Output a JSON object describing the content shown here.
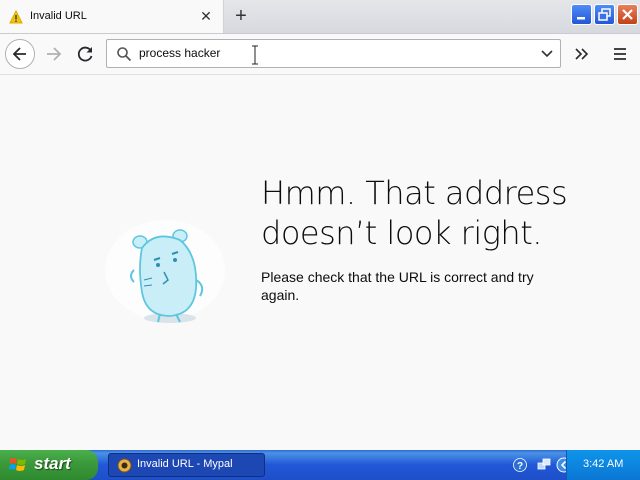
{
  "browser": {
    "tab": {
      "title": "Invalid URL",
      "warning_icon": "warning-icon",
      "close_icon": "close-icon"
    },
    "new_tab_icon": "plus-icon",
    "window_controls": {
      "minimize": "minimize-icon",
      "maximize": "restore-icon",
      "close": "close-icon"
    }
  },
  "toolbar": {
    "back_icon": "arrow-left-icon",
    "forward_icon": "arrow-right-icon",
    "reload_icon": "reload-icon",
    "url_value": "process hacker",
    "url_search_icon": "search-icon",
    "dropdown_icon": "chevron-down-icon",
    "overflow_icon": "double-chevron-right-icon",
    "menu_icon": "hamburger-menu-icon"
  },
  "error_page": {
    "title": "Hmm. That address doesn’t look right.",
    "message": "Please check that the URL is correct and try again.",
    "illustration": "confused-creature-illustration"
  },
  "taskbar": {
    "start_label": "start",
    "task_item_label": "Invalid URL - Mypal",
    "clock": "3:42 AM"
  },
  "colors": {
    "page_background": "#f9f9fa",
    "taskbar_blue": "#2157d7",
    "start_green": "#3c9a3c",
    "tray_blue": "#0f94ea"
  }
}
